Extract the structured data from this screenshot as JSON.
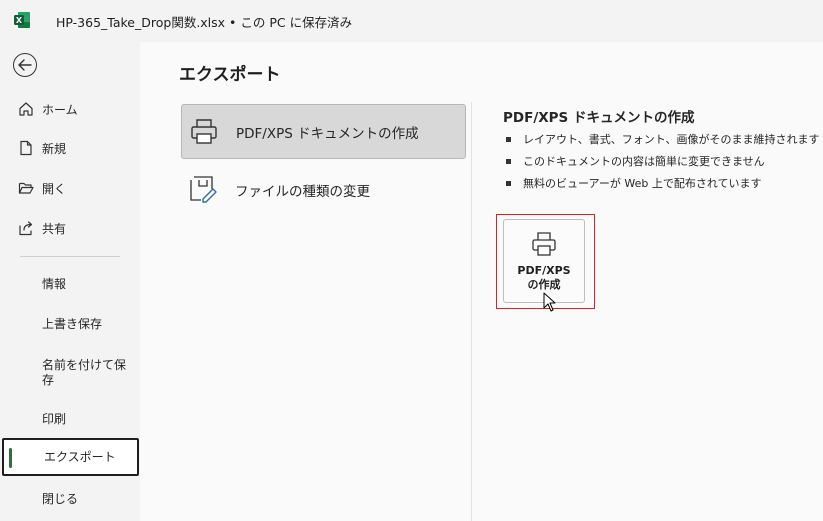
{
  "titlebar": {
    "title": "HP-365_Take_Drop関数.xlsx • この PC に保存済み"
  },
  "nav": {
    "back_icon": "back-arrow-icon",
    "primary": [
      {
        "label": "ホーム",
        "icon": "home-icon"
      },
      {
        "label": "新規",
        "icon": "new-document-icon"
      },
      {
        "label": "開く",
        "icon": "open-folder-icon"
      },
      {
        "label": "共有",
        "icon": "share-icon"
      }
    ],
    "secondary": [
      {
        "label": "情報"
      },
      {
        "label": "上書き保存"
      },
      {
        "label": "名前を付けて保存"
      },
      {
        "label": "印刷"
      },
      {
        "label": "エクスポート",
        "selected": true
      },
      {
        "label": "閉じる"
      }
    ]
  },
  "main": {
    "heading": "エクスポート",
    "options": [
      {
        "label": "PDF/XPS ドキュメントの作成",
        "icon": "printer-document-icon",
        "selected": true
      },
      {
        "label": "ファイルの種類の変更",
        "icon": "change-file-type-icon",
        "selected": false
      }
    ],
    "detail": {
      "title": "PDF/XPS ドキュメントの作成",
      "bullets": [
        "レイアウト、書式、フォント、画像がそのまま維持されます",
        "このドキュメントの内容は簡単に変更できません",
        "無料のビューアーが Web 上で配布されています"
      ],
      "button": {
        "line1": "PDF/XPS",
        "line2": "の作成",
        "icon": "printer-icon"
      }
    }
  },
  "colors": {
    "highlight": "#e02020",
    "excel_green": "#1d6f42",
    "selected_bar": "#2f6f3f"
  }
}
